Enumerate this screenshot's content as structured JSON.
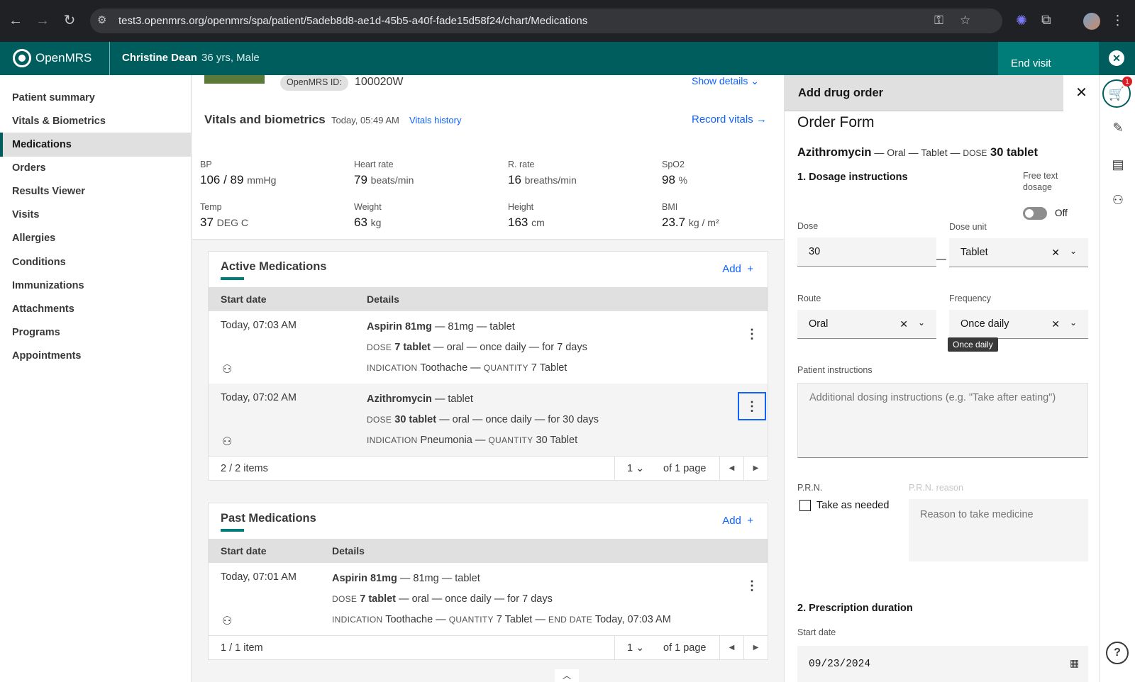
{
  "browser": {
    "url": "test3.openmrs.org/openmrs/spa/patient/5adeb8d8-ae1d-45b5-a40f-fade15d58f24/chart/Medications"
  },
  "header": {
    "brand": "OpenMRS",
    "patient_name": "Christine Dean",
    "patient_info": "36 yrs, Male",
    "end_visit": "End visit"
  },
  "nav": {
    "items": [
      "Patient summary",
      "Vitals & Biometrics",
      "Medications",
      "Orders",
      "Results Viewer",
      "Visits",
      "Allergies",
      "Conditions",
      "Immunizations",
      "Attachments",
      "Programs",
      "Appointments"
    ],
    "active": "Medications"
  },
  "banner": {
    "id_label": "OpenMRS ID:",
    "id_value": "100020W",
    "show_details": "Show details"
  },
  "vitals": {
    "title": "Vitals and biometrics",
    "timestamp": "Today, 05:49 AM",
    "history_link": "Vitals history",
    "record": "Record vitals",
    "items": [
      {
        "label": "BP",
        "value": "106 / 89",
        "unit": "mmHg"
      },
      {
        "label": "Heart rate",
        "value": "79",
        "unit": "beats/min"
      },
      {
        "label": "R. rate",
        "value": "16",
        "unit": "breaths/min"
      },
      {
        "label": "SpO2",
        "value": "98",
        "unit": "%"
      },
      {
        "label": "Temp",
        "value": "37",
        "unit": "DEG C"
      },
      {
        "label": "Weight",
        "value": "63",
        "unit": "kg"
      },
      {
        "label": "Height",
        "value": "163",
        "unit": "cm"
      },
      {
        "label": "BMI",
        "value": "23.7",
        "unit": "kg / m²"
      }
    ]
  },
  "active_meds": {
    "title": "Active Medications",
    "add": "Add",
    "col_start": "Start date",
    "col_details": "Details",
    "rows": [
      {
        "date": "Today, 07:03 AM",
        "drug": "Aspirin 81mg",
        "drug_rest": " — 81mg — tablet",
        "dose_cap": "DOSE",
        "dose": "7 tablet",
        "dose_rest": " — oral — once daily — for 7 days",
        "ind_cap": "INDICATION",
        "ind": " Toothache — ",
        "qty_cap": "QUANTITY",
        "qty": " 7 Tablet"
      },
      {
        "date": "Today, 07:02 AM",
        "drug": "Azithromycin",
        "drug_rest": " — tablet",
        "dose_cap": "DOSE",
        "dose": "30 tablet",
        "dose_rest": " — oral — once daily — for 30 days",
        "ind_cap": "INDICATION",
        "ind": " Pneumonia — ",
        "qty_cap": "QUANTITY",
        "qty": " 30 Tablet"
      }
    ],
    "count": "2 / 2 items",
    "page": "1",
    "of_pages": "of 1 page"
  },
  "past_meds": {
    "title": "Past Medications",
    "add": "Add",
    "col_start": "Start date",
    "col_details": "Details",
    "row": {
      "date": "Today, 07:01 AM",
      "drug": "Aspirin 81mg",
      "drug_rest": " — 81mg — tablet",
      "dose_cap": "DOSE",
      "dose": "7 tablet",
      "dose_rest": " — oral — once daily — for 7 days",
      "ind_cap": "INDICATION",
      "ind": " Toothache — ",
      "qty_cap": "QUANTITY",
      "qty": " 7 Tablet — ",
      "end_cap": "END DATE",
      "end": " Today, 07:03 AM"
    },
    "count": "1 / 1 item",
    "page": "1",
    "of_pages": "of 1 page"
  },
  "order_panel": {
    "title": "Add drug order",
    "form_title": "Order Form",
    "drug_name": "Azithromycin",
    "drug_route": " — Oral — Tablet — ",
    "dose_cap": "DOSE",
    "dose_val": " 30 tablet",
    "section1": "1. Dosage instructions",
    "free_text": "Free text dosage",
    "toggle_state": "Off",
    "dose_label": "Dose",
    "dose_value": "30",
    "dose_unit_label": "Dose unit",
    "dose_unit_value": "Tablet",
    "route_label": "Route",
    "route_value": "Oral",
    "frequency_label": "Frequency",
    "frequency_value": "Once daily",
    "tooltip": "Once daily",
    "patient_instr_label": "Patient instructions",
    "patient_instr_placeholder": "Additional dosing instructions (e.g. \"Take after eating\")",
    "prn_label": "P.R.N.",
    "prn_checkbox": "Take as needed",
    "prn_reason_label": "P.R.N. reason",
    "prn_reason_placeholder": "Reason to take medicine",
    "section2": "2. Prescription duration",
    "start_date_label": "Start date",
    "start_date_value": "09/23/2024"
  },
  "rail": {
    "cart_count": "1"
  }
}
